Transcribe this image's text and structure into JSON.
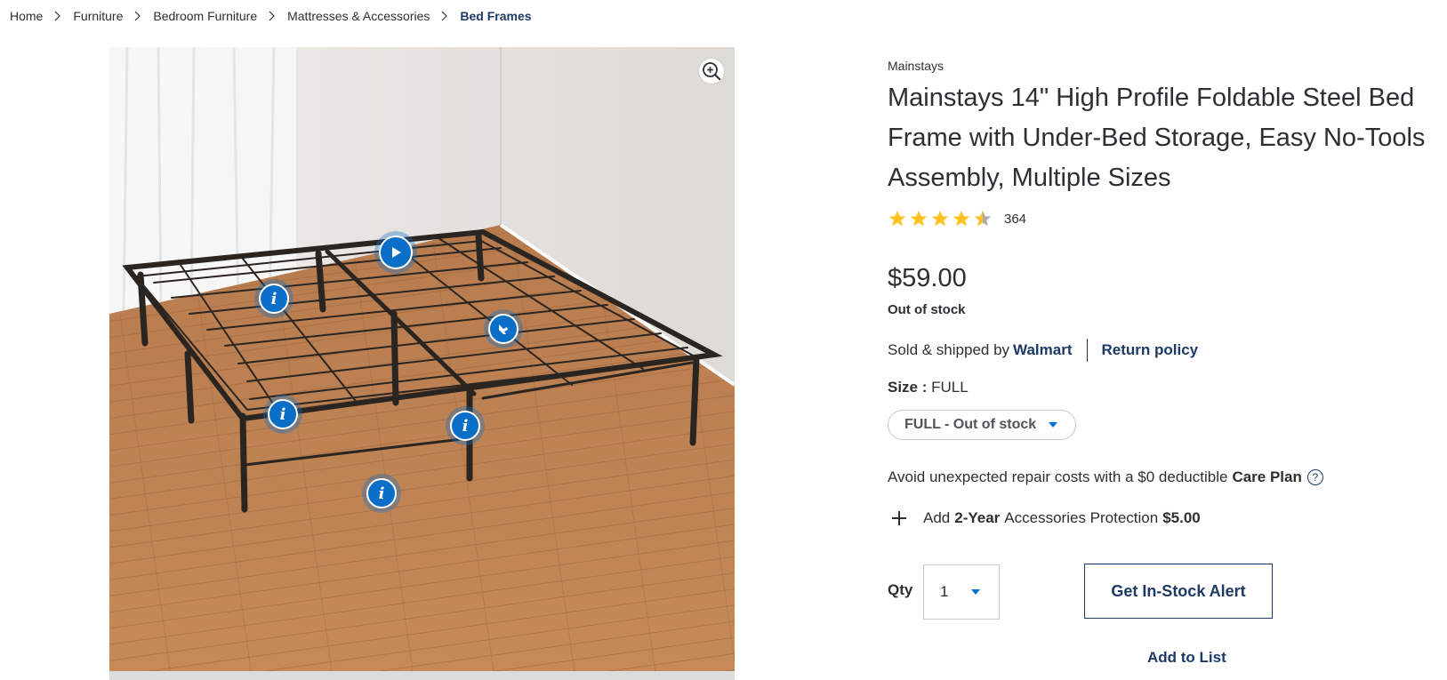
{
  "breadcrumb": [
    "Home",
    "Furniture",
    "Bedroom Furniture",
    "Mattresses & Accessories",
    "Bed Frames"
  ],
  "product": {
    "brand": "Mainstays",
    "title": "Mainstays 14\" High Profile Foldable Steel Bed Frame with Under-Bed Storage, Easy No-Tools Assembly, Multiple Sizes",
    "rating": 4.5,
    "review_count": "364",
    "price": "$59.00",
    "stock_status": "Out of stock"
  },
  "seller": {
    "prefix": "Sold & shipped by",
    "name": "Walmart",
    "return_policy": "Return policy"
  },
  "size": {
    "label": "Size :",
    "value": "FULL",
    "selected_option": "FULL - Out of stock"
  },
  "care_plan": {
    "text": "Avoid unexpected repair costs with a $0 deductible",
    "name": "Care Plan",
    "help_icon": "?"
  },
  "protection": {
    "prefix": "Add",
    "term": "2-Year",
    "mid": "Accessories Protection",
    "price": "$5.00"
  },
  "quantity": {
    "label": "Qty",
    "value": "1"
  },
  "actions": {
    "alert": "Get In-Stock Alert",
    "add_to_list": "Add to List"
  },
  "hotspot_icon": "i",
  "colors": {
    "brand_blue": "#1d3a66",
    "accent_blue": "#0071dc",
    "star": "#ffc220",
    "text": "#2e2f32"
  }
}
